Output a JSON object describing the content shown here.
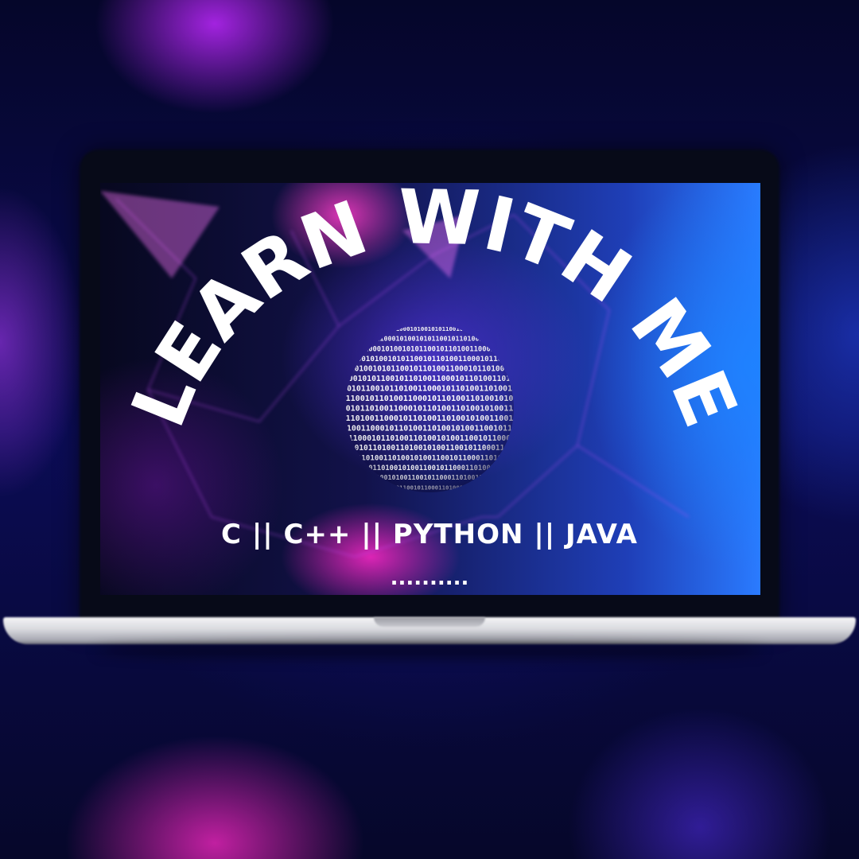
{
  "headline": "LEARN WITH ME",
  "subtitle": "C || C++ || PYTHON || JAVA",
  "ellipsis": "..........",
  "binary_pattern": "0101001100101100011010011000101001010110010110100110001011010011010",
  "colors": {
    "text": "#ffffff",
    "background": "#07082e",
    "accent_magenta": "#ff3cc8",
    "accent_blue": "#2a7bff"
  }
}
